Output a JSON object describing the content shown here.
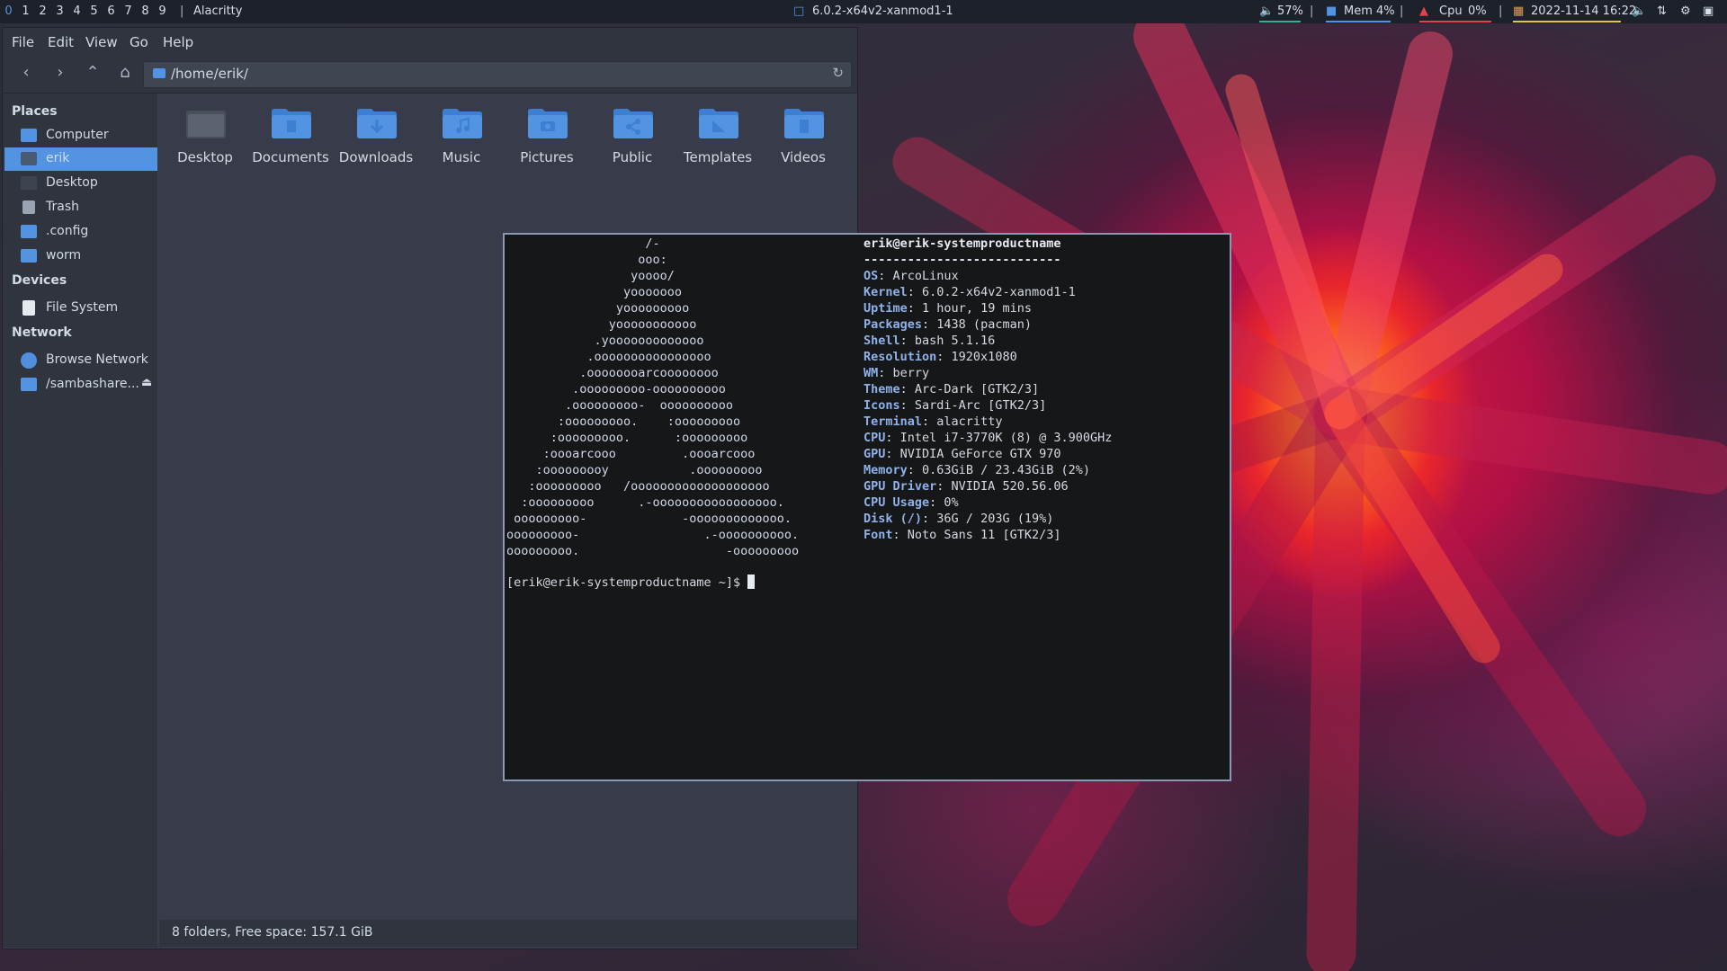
{
  "topbar": {
    "workspaces": [
      "0",
      "1",
      "2",
      "3",
      "4",
      "5",
      "6",
      "7",
      "8",
      "9"
    ],
    "active_workspace": "0",
    "window_title": "Alacritty",
    "kernel": "6.0.2-x64v2-xanmod1-1",
    "volume": "57%",
    "memory": "Mem 4%",
    "cpu_label": "Cpu",
    "cpu_value": "0%",
    "datetime": "2022-11-14 16:22",
    "separator": "|"
  },
  "file_manager": {
    "menu": [
      "File",
      "Edit",
      "View",
      "Go",
      "Help"
    ],
    "path": "/home/erik/",
    "sidebar": {
      "places_heading": "Places",
      "places": [
        {
          "label": "Computer",
          "icon": "computer-icon"
        },
        {
          "label": "erik",
          "icon": "home-icon",
          "selected": true
        },
        {
          "label": "Desktop",
          "icon": "desktop-icon"
        },
        {
          "label": "Trash",
          "icon": "trash-icon"
        },
        {
          "label": ".config",
          "icon": "folder-icon"
        },
        {
          "label": "worm",
          "icon": "folder-icon"
        }
      ],
      "devices_heading": "Devices",
      "devices": [
        {
          "label": "File System",
          "icon": "drive-icon"
        }
      ],
      "network_heading": "Network",
      "network": [
        {
          "label": "Browse Network",
          "icon": "network-icon"
        },
        {
          "label": "/sambashare...",
          "icon": "folder-icon",
          "eject": "⏏"
        }
      ]
    },
    "folders": [
      "Desktop",
      "Documents",
      "Downloads",
      "Music",
      "Pictures",
      "Public",
      "Templates",
      "Videos"
    ],
    "status": "8 folders, Free space: 157.1 GiB"
  },
  "terminal": {
    "ascii_art": [
      "                   /-",
      "                  ooo:",
      "                 yoooo/",
      "                yooooooo",
      "               yooooooooo",
      "              yooooooooooo",
      "            .yooooooooooooo",
      "           .oooooooooooooooo",
      "          .oooooooarcoooooooo",
      "         .ooooooooo-oooooooooo",
      "        .ooooooooo-  oooooooooo",
      "       :ooooooooo.    :ooooooooo",
      "      :ooooooooo.      :ooooooooo",
      "     :oooarcooo         .oooarcooo",
      "    :ooooooooy           .ooooooooo",
      "   :ooooooooo   /ooooooooooooooooooo",
      "  :ooooooooo      .-ooooooooooooooooo.",
      " ooooooooo-             -ooooooooooooo.",
      "ooooooooo-                 .-oooooooooo.",
      "ooooooooo.                    -ooooooooo"
    ],
    "title": "erik@erik-systemproductname",
    "underline": "---------------------------",
    "info": [
      {
        "key": "OS",
        "value": "ArcoLinux"
      },
      {
        "key": "Kernel",
        "value": "6.0.2-x64v2-xanmod1-1"
      },
      {
        "key": "Uptime",
        "value": "1 hour, 19 mins"
      },
      {
        "key": "Packages",
        "value": "1438 (pacman)"
      },
      {
        "key": "Shell",
        "value": "bash 5.1.16"
      },
      {
        "key": "Resolution",
        "value": "1920x1080"
      },
      {
        "key": "WM",
        "value": "berry"
      },
      {
        "key": "Theme",
        "value": "Arc-Dark [GTK2/3]"
      },
      {
        "key": "Icons",
        "value": "Sardi-Arc [GTK2/3]"
      },
      {
        "key": "Terminal",
        "value": "alacritty"
      },
      {
        "key": "CPU",
        "value": "Intel i7-3770K (8) @ 3.900GHz"
      },
      {
        "key": "GPU",
        "value": "NVIDIA GeForce GTX 970"
      },
      {
        "key": "Memory",
        "value": "0.63GiB / 23.43GiB (2%)"
      },
      {
        "key": "GPU Driver",
        "value": "NVIDIA 520.56.06"
      },
      {
        "key": "CPU Usage",
        "value": "0%"
      },
      {
        "key": "Disk (/)",
        "value": "36G / 203G (19%)"
      },
      {
        "key": "Font",
        "value": "Noto Sans 11 [GTK2/3]"
      }
    ],
    "prompt": "[erik@erik-systemproductname ~]$ "
  },
  "colors": {
    "accent": "#5294e2",
    "terminal_bg": "#161718",
    "fm_bg": "#383c4a"
  }
}
